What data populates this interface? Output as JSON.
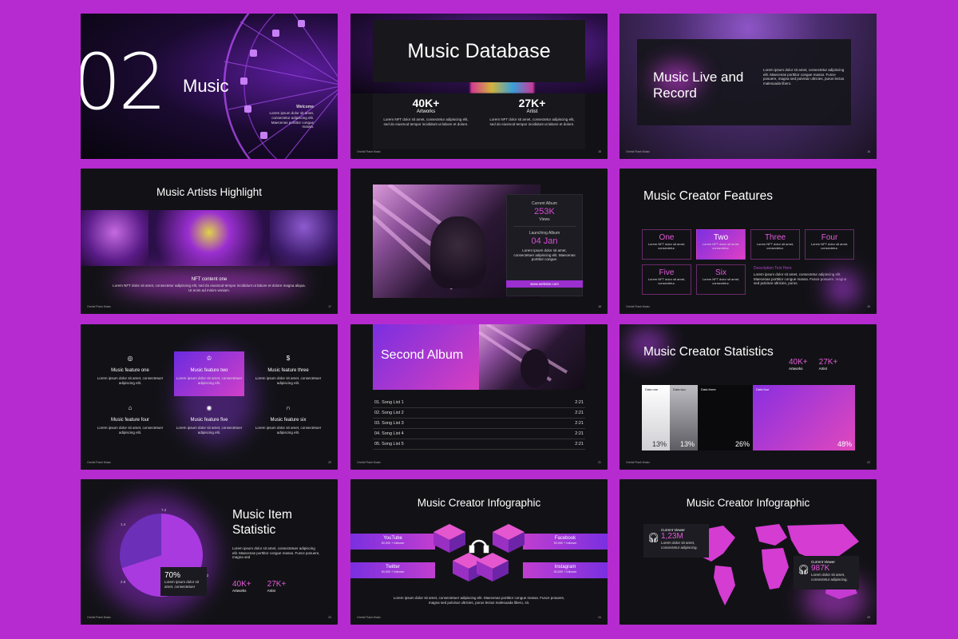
{
  "slides": {
    "s1": {
      "number": "02",
      "title": "Music",
      "welcome": "Welcome",
      "text": "Lorem ipsum dolor sit amet, consectetur adipiscing elit. Maecenas porttitor congue massa.",
      "footer": "Orchid Flash Music",
      "page": "02"
    },
    "s2": {
      "title": "Music Database",
      "stat1": {
        "value": "40K+",
        "label": "Artworks",
        "text": "Lorem NFT dolor sit amet, consectetur adipiscing elit, sed do eiusmod tempor incididunt ut labore et dolore."
      },
      "stat2": {
        "value": "27K+",
        "label": "Artist",
        "text": "Lorem NFT dolor sit amet, consectetur adipiscing elit, sed do eiusmod tempor incididunt ut labore et dolore."
      },
      "footer": "Orchid Flash Music",
      "page": "15"
    },
    "s3": {
      "title": "Music Live and Record",
      "text": "Lorem ipsum dolor sit amet, consectetur adipiscing elit. Maecenas porttitor congue massa. Fusce posuere, magna sed pulvinar ultricies, purus lectus malesuada libero.",
      "footer": "Orchid Flash Music",
      "page": "16"
    },
    "s4": {
      "title": "Music Artists Highlight",
      "subtitle": "NFT content one",
      "text": "Lorem NFT dolor sit amet, consectetur adipiscing elit, sed do eiusmod tempor incididunt ut labore et dolore magna aliqua. Ut enim ad minim veniam.",
      "footer": "Orchid Flash Music",
      "page": "17"
    },
    "s5": {
      "label1": "Current Album",
      "value1": "253K",
      "sub1": "Views",
      "label2": "Launching Album",
      "value2": "04 Jan",
      "text": "Lorem ipsum dolor sit amet, consectetuer adipiscing elit. Maecenas porttitor congue.",
      "button": "www.website.com",
      "page": "18"
    },
    "s6": {
      "title": "Music Creator Features",
      "features": [
        {
          "name": "One",
          "text": "Lorem NFT dolor sit amet, consectetur."
        },
        {
          "name": "Two",
          "text": "Lorem NFT dolor sit amet, consectetur."
        },
        {
          "name": "Three",
          "text": "Lorem NFT dolor sit amet, consectetur."
        },
        {
          "name": "Four",
          "text": "Lorem NFT dolor sit amet, consectetur."
        },
        {
          "name": "Five",
          "text": "Lorem NFT dolor sit amet, consectetur."
        },
        {
          "name": "Six",
          "text": "Lorem NFT dolor sit amet, consectetur."
        }
      ],
      "desc_title": "Description Text Here",
      "desc_text": "Lorem ipsum dolor sit amet, consectetur adipiscing elit. Maecenas porttitor congue massa. Fusce posuere, magna sed pulvinar ultricies, purus.",
      "footer": "Orchid Flash Music",
      "page": "19"
    },
    "s7": {
      "items": [
        {
          "icon": "◎",
          "title": "Music feature one",
          "text": "Lorem ipsum dolor sit amet, consectetuer adipiscing elit."
        },
        {
          "icon": "♔",
          "title": "Music feature two",
          "text": "Lorem ipsum dolor sit amet, consectetuer adipiscing elit."
        },
        {
          "icon": "$",
          "title": "Music feature three",
          "text": "Lorem ipsum dolor sit amet, consectetuer adipiscing elit."
        },
        {
          "icon": "⌂",
          "title": "Music feature four",
          "text": "Lorem ipsum dolor sit amet, consectetuer adipiscing elit."
        },
        {
          "icon": "◉",
          "title": "Music feature five",
          "text": "Lorem ipsum dolor sit amet, consectetuer adipiscing elit."
        },
        {
          "icon": "∩",
          "title": "Music feature six",
          "text": "Lorem ipsum dolor sit amet, consectetuer adipiscing elit."
        }
      ],
      "footer": "Orchid Flash Music",
      "page": "20"
    },
    "s8": {
      "title": "Second Album",
      "songs": [
        {
          "name": "01. Song List 1",
          "time": "2:21"
        },
        {
          "name": "02. Song List 2",
          "time": "2:21"
        },
        {
          "name": "03. Song List 3",
          "time": "2:21"
        },
        {
          "name": "04. Song List 4",
          "time": "2:21"
        },
        {
          "name": "05. Song List 5",
          "time": "2:21"
        }
      ],
      "footer": "Orchid Flash Music",
      "page": "21"
    },
    "s9": {
      "title": "Music Creator Statistics",
      "stat1": {
        "value": "40K+",
        "label": "Artworks"
      },
      "stat2": {
        "value": "27K+",
        "label": "Artist"
      },
      "footer": "Orchid Flash Music",
      "page": "22"
    },
    "s10": {
      "title": "Music Item Statistic",
      "text": "Lorem ipsum dolor sit amet, consectetuer adipiscing elit. Maecenas porttitor congue massa. Fusce posuere, magna sed",
      "callout_value": "70%",
      "callout_text": "Lorem ipsum dolor sit amet, consectetuer",
      "stat1": {
        "value": "40K+",
        "label": "Artworks"
      },
      "stat2": {
        "value": "27K+",
        "label": "Artist"
      },
      "pie_labels": [
        "7.2",
        "1.4",
        "2.8",
        "8.2"
      ],
      "footer": "Orchid Flash Music",
      "page": "23"
    },
    "s11": {
      "title": "Music Creator Infographic",
      "items": [
        {
          "name": "YouTube",
          "followers": "30,000 + follower"
        },
        {
          "name": "Facebook",
          "followers": "30,000 + follower"
        },
        {
          "name": "Twitter",
          "followers": "30,000 + follower"
        },
        {
          "name": "Instagram",
          "followers": "30,000 + follower"
        }
      ],
      "text": "Lorem ipsum dolor sit amet, consectetuer adipiscing elit. Maecenas porttitor congue massa. Fusce posuere, magna sed pulvinar ultricies, purus lectus malesuada libero, sit.",
      "footer": "Orchid Flash Music",
      "page": "24"
    },
    "s12": {
      "title": "Music Creator Infographic",
      "viewer1": {
        "label": "Current Viewer",
        "value": "1,23M",
        "text": "Lorem dolor sit amet, consectetur adipiscing."
      },
      "viewer2": {
        "label": "Current Viewer",
        "value": "987K",
        "text": "Lorem dolor sit amet, consectetur adipiscing."
      },
      "page": "25"
    }
  },
  "chart_data": [
    {
      "type": "bar",
      "categories": [
        "Data one",
        "Data two",
        "Data three",
        "Data four"
      ],
      "values": [
        13,
        13,
        26,
        48
      ],
      "ylim": [
        0,
        100
      ]
    },
    {
      "type": "pie",
      "categories": [
        "70%"
      ],
      "values": [
        70,
        30
      ],
      "labels": [
        "7.2",
        "1.4",
        "2.8",
        "8.2"
      ]
    }
  ],
  "colors": {
    "background": "#b52bd0",
    "slide": "#121216",
    "accent": "#e45ad8",
    "gradient_start": "#7a2fe0",
    "gradient_end": "#d63fc0"
  }
}
